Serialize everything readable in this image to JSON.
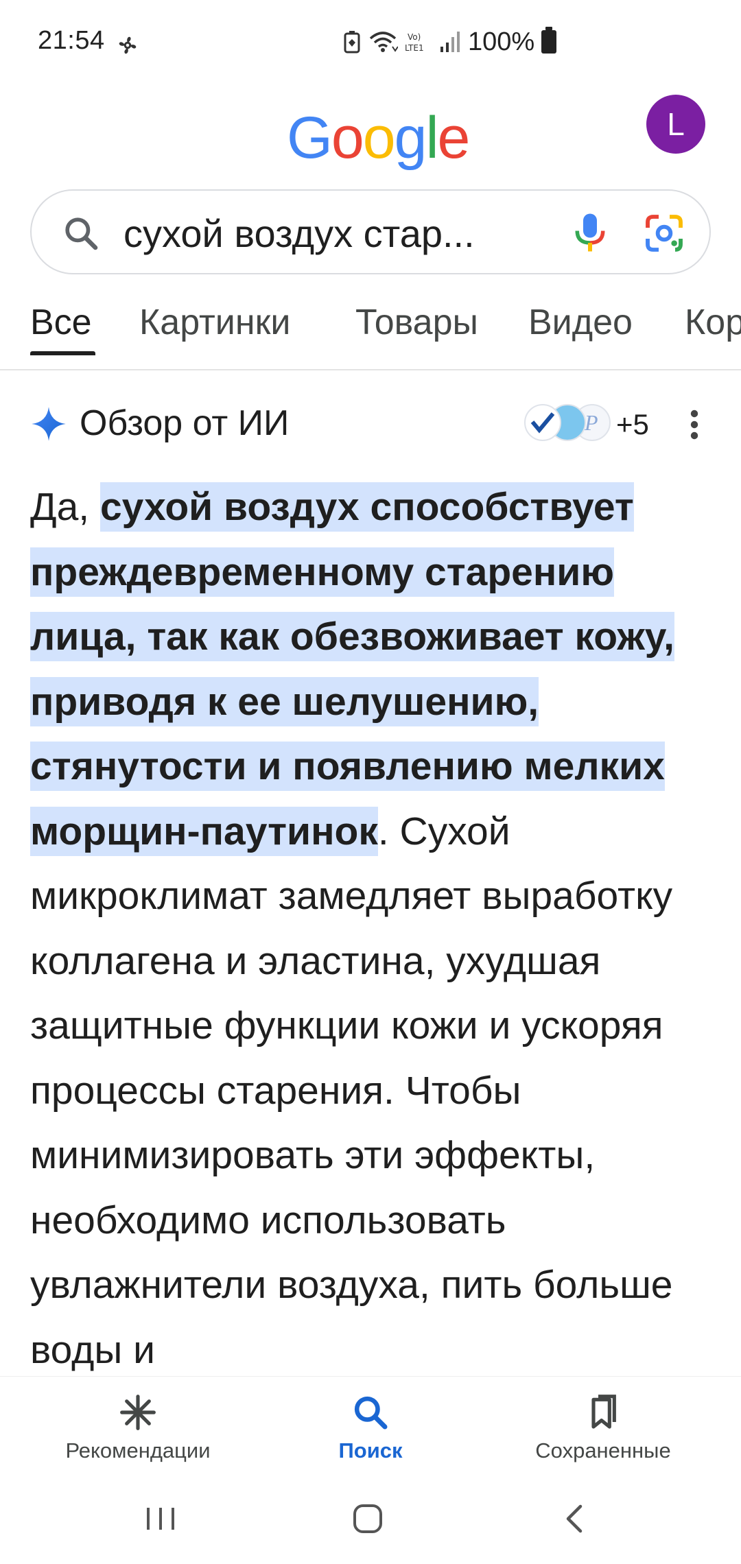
{
  "status_bar": {
    "time": "21:54",
    "battery": "100%",
    "network": "LTE1"
  },
  "header": {
    "logo_letters": [
      "G",
      "o",
      "o",
      "g",
      "l",
      "e"
    ],
    "logo_colors": [
      "#4285F4",
      "#EA4335",
      "#FBBC05",
      "#4285F4",
      "#34A853",
      "#EA4335"
    ],
    "avatar_initial": "L",
    "avatar_color": "#7b1fa2"
  },
  "search": {
    "query": "сухой воздух стар..."
  },
  "tabs": [
    {
      "label": "Все",
      "active": true
    },
    {
      "label": "Картинки",
      "active": false
    },
    {
      "label": "Товары",
      "active": false
    },
    {
      "label": "Видео",
      "active": false
    },
    {
      "label": "Кор",
      "active": false
    }
  ],
  "ai_overview": {
    "title": "Обзор от ИИ",
    "extra_sources": "+5",
    "text_prefix": "Да, ",
    "text_highlight": "сухой воздух способствует преждевременному старению лица, так как обезвоживает кожу, приводя к ее шелушению, стянутости и появлению мелких морщин-паутинок",
    "text_rest": ". Сухой микроклимат замедляет выработку коллагена и эластина, ухудшая защитные функции кожи и ускоряя процессы старения. Чтобы минимизировать эти эффекты, необходимо использовать увлажнители воздуха, пить больше воды и",
    "highlight_color": "#d3e3fd"
  },
  "bottom_nav": [
    {
      "label": "Рекомендации",
      "icon": "asterisk-icon",
      "active": false
    },
    {
      "label": "Поиск",
      "icon": "search-icon",
      "active": true
    },
    {
      "label": "Сохраненные",
      "icon": "bookmarks-icon",
      "active": false
    }
  ],
  "colors": {
    "accent": "#1a66d2",
    "text": "#1f1f1f"
  }
}
